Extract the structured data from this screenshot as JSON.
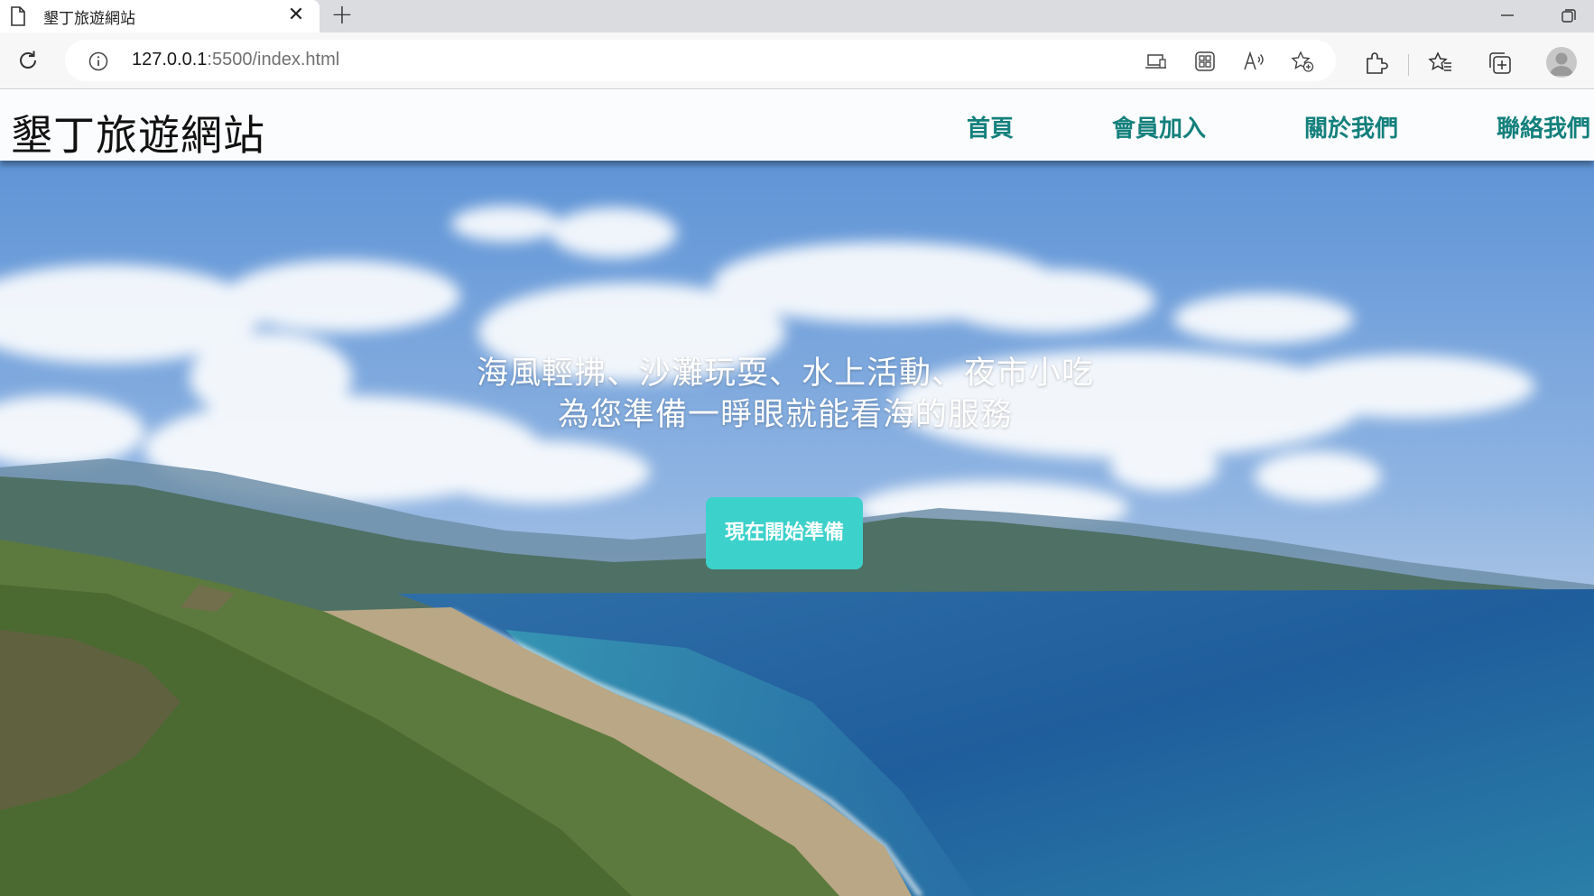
{
  "browser": {
    "tab_title": "墾丁旅遊網站",
    "url_host": "127.0.0.1",
    "url_rest": ":5500/index.html",
    "icons": [
      "page-icon",
      "close-icon",
      "plus-icon",
      "minimize-icon",
      "restore-icon",
      "reload-icon",
      "info-icon",
      "app-available-icon",
      "browser-essentials-icon",
      "read-aloud-icon",
      "add-favorite-icon",
      "extensions-icon",
      "favorites-icon",
      "collections-icon",
      "profile-icon"
    ]
  },
  "site": {
    "logo": "墾丁旅遊網站",
    "nav": [
      {
        "label": "首頁"
      },
      {
        "label": "會員加入"
      },
      {
        "label": "關於我們"
      },
      {
        "label": "聯絡我們"
      }
    ],
    "accent_color": "#14807c"
  },
  "hero": {
    "line1": "海風輕拂、沙灘玩耍、水上活動、夜市小吃",
    "line2": "為您準備一睜眼就能看海的服務",
    "cta": "現在開始準備",
    "cta_color": "#3dd1cb"
  }
}
